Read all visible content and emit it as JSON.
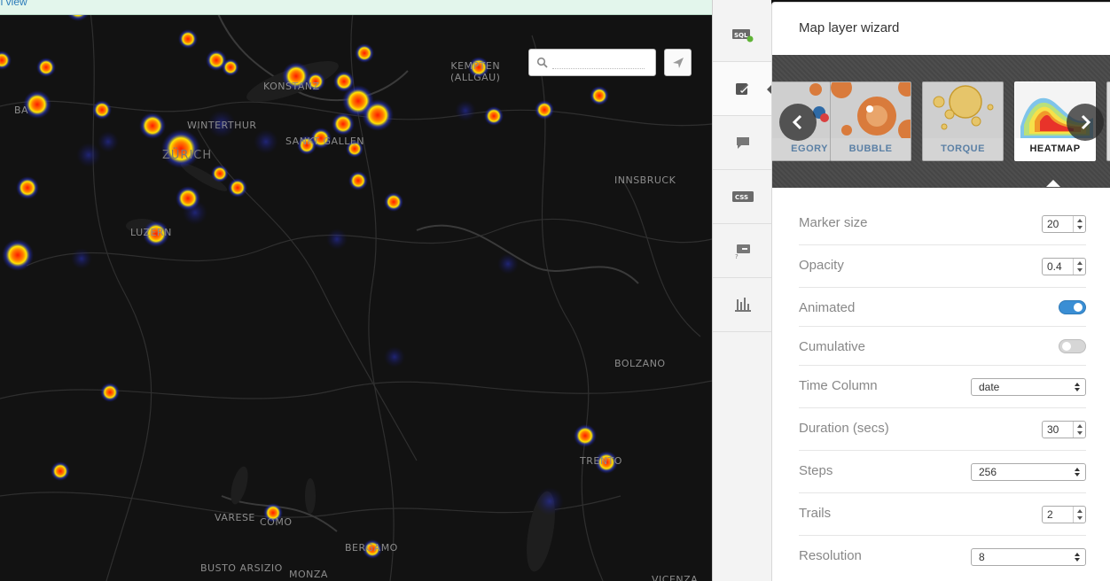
{
  "topbar": {
    "link_text": "ql view"
  },
  "map": {
    "search_placeholder": "",
    "cities": [
      {
        "name": "Kempten\n(Allgäu)",
        "label": "KEMPTEN",
        "sub": "(ALLGAU)"
      },
      {
        "name": "Konstanz",
        "label": "KONSTANZ"
      },
      {
        "name": "Winterthur",
        "label": "WINTERTHUR"
      },
      {
        "name": "Zürich",
        "label": "ZÜRICH"
      },
      {
        "name": "St. Gallen",
        "label": "SANKT GALLEN"
      },
      {
        "name": "Innsbruck",
        "label": "INNSBRUCK"
      },
      {
        "name": "Luzern",
        "label": "LUZERN"
      },
      {
        "name": "Bolzano",
        "label": "BOLZANO"
      },
      {
        "name": "Trento",
        "label": "TRENTO"
      },
      {
        "name": "Varese",
        "label": "VARESE"
      },
      {
        "name": "Como",
        "label": "COMO"
      },
      {
        "name": "Bergamo",
        "label": "BERGAMO"
      },
      {
        "name": "Busto Arsizio",
        "label": "BUSTO ARSIZIO"
      },
      {
        "name": "Monza",
        "label": "MONZA"
      },
      {
        "name": "Vicenza",
        "label": "VICENZA"
      },
      {
        "name": "Basel",
        "label": "BA"
      }
    ]
  },
  "rail": {
    "items": [
      {
        "name": "sql-icon",
        "label": "SQL"
      },
      {
        "name": "wizard-icon"
      },
      {
        "name": "infowindow-icon"
      },
      {
        "name": "css-icon",
        "label": "CSS"
      },
      {
        "name": "legend-icon"
      },
      {
        "name": "filters-icon"
      }
    ]
  },
  "panel": {
    "title": "Map layer wizard",
    "thumbs": [
      {
        "label": "EGORY"
      },
      {
        "label": "BUBBLE"
      },
      {
        "label": "TORQUE"
      },
      {
        "label": "HEATMAP"
      }
    ],
    "fields": {
      "marker_size": {
        "label": "Marker size",
        "value": "20"
      },
      "opacity": {
        "label": "Opacity",
        "value": "0.4"
      },
      "animated": {
        "label": "Animated",
        "state": "on"
      },
      "cumulative": {
        "label": "Cumulative",
        "state": "off"
      },
      "time_column": {
        "label": "Time Column",
        "value": "date"
      },
      "duration": {
        "label": "Duration (secs)",
        "value": "30"
      },
      "steps": {
        "label": "Steps",
        "value": "256"
      },
      "trails": {
        "label": "Trails",
        "value": "2"
      },
      "resolution": {
        "label": "Resolution",
        "value": "8"
      }
    }
  },
  "colors": {
    "accent": "#3a8ed4",
    "map_bg": "#121212",
    "heat_hot": "#ff2a00",
    "heat_warm": "#ffe600",
    "heat_cool": "#1a1aa0"
  }
}
